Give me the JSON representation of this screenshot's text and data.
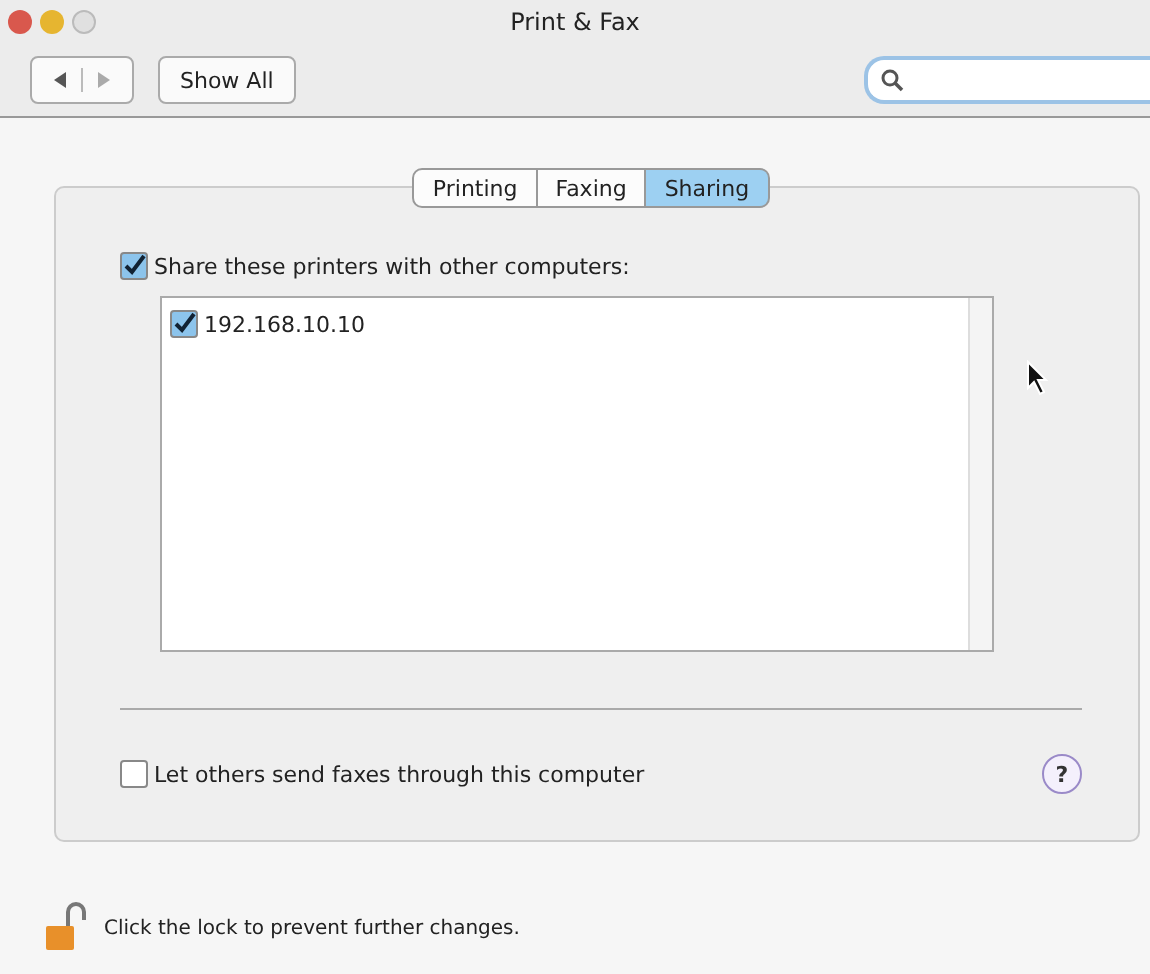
{
  "window": {
    "title": "Print & Fax"
  },
  "toolbar": {
    "show_all": "Show All"
  },
  "tabs": [
    {
      "label": "Printing",
      "selected": false
    },
    {
      "label": "Faxing",
      "selected": false
    },
    {
      "label": "Sharing",
      "selected": true
    }
  ],
  "share_printers": {
    "label": "Share these printers with other computers:",
    "checked": true
  },
  "printers": [
    {
      "name": "192.168.10.10",
      "checked": true
    }
  ],
  "fax_sharing": {
    "label": "Let others send faxes through this computer",
    "checked": false
  },
  "help": "?",
  "lock": {
    "label": "Click the lock to prevent further changes."
  }
}
